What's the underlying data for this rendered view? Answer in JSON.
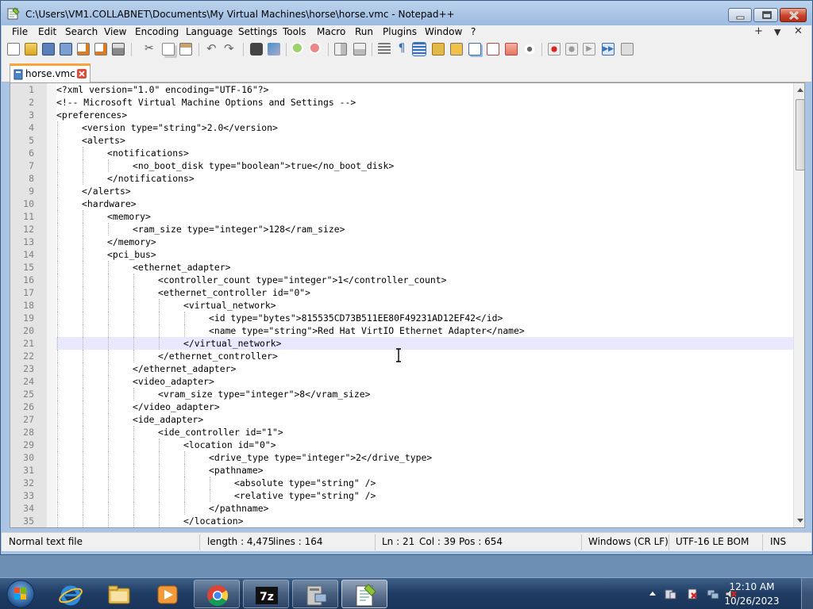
{
  "window": {
    "title": "C:\\Users\\VM1.COLLABNET\\Documents\\My Virtual Machines\\horse\\horse.vmc - Notepad++"
  },
  "menu": {
    "items": [
      "File",
      "Edit",
      "Search",
      "View",
      "Encoding",
      "Language",
      "Settings",
      "Tools",
      "Macro",
      "Run",
      "Plugins",
      "Window",
      "?"
    ],
    "right": [
      "+",
      "▼",
      "✕"
    ]
  },
  "toolbar": {
    "icons": [
      "new-file-icon",
      "open-file-icon",
      "save-icon",
      "save-all-icon",
      "close-icon",
      "close-all-icon",
      "print-icon",
      "cut-icon",
      "copy-icon",
      "paste-icon",
      "undo-icon",
      "redo-icon",
      "find-icon",
      "replace-icon",
      "zoom-in-icon",
      "zoom-out-icon",
      "sync-vertical-icon",
      "sync-horizontal-icon",
      "word-wrap-icon",
      "show-all-chars-icon",
      "indent-guide-icon",
      "user-language-icon",
      "doc-map-icon",
      "function-list-icon",
      "folder-as-workspace-icon",
      "monitoring-icon",
      "record-macro-icon",
      "stop-macro-icon",
      "play-macro-icon",
      "run-macro-multiple-icon",
      "save-macro-icon"
    ]
  },
  "tabs": [
    {
      "label": "horse.vmc",
      "active": true
    }
  ],
  "editor": {
    "active_line": 21,
    "lines": [
      {
        "n": "1",
        "indent": 0,
        "text": "<?xml version=\"1.0\" encoding=\"UTF-16\"?>"
      },
      {
        "n": "2",
        "indent": 0,
        "text": "<!-- Microsoft Virtual Machine Options and Settings -->"
      },
      {
        "n": "3",
        "indent": 0,
        "text": "<preferences>"
      },
      {
        "n": "4",
        "indent": 1,
        "text": "<version type=\"string\">2.0</version>"
      },
      {
        "n": "5",
        "indent": 1,
        "text": "<alerts>"
      },
      {
        "n": "6",
        "indent": 2,
        "text": "<notifications>"
      },
      {
        "n": "7",
        "indent": 3,
        "text": "<no_boot_disk type=\"boolean\">true</no_boot_disk>"
      },
      {
        "n": "8",
        "indent": 2,
        "text": "</notifications>"
      },
      {
        "n": "9",
        "indent": 1,
        "text": "</alerts>"
      },
      {
        "n": "10",
        "indent": 1,
        "text": "<hardware>"
      },
      {
        "n": "11",
        "indent": 2,
        "text": "<memory>"
      },
      {
        "n": "12",
        "indent": 3,
        "text": "<ram_size type=\"integer\">128</ram_size>"
      },
      {
        "n": "13",
        "indent": 2,
        "text": "</memory>"
      },
      {
        "n": "14",
        "indent": 2,
        "text": "<pci_bus>"
      },
      {
        "n": "15",
        "indent": 3,
        "text": "<ethernet_adapter>"
      },
      {
        "n": "16",
        "indent": 4,
        "text": "<controller_count type=\"integer\">1</controller_count>"
      },
      {
        "n": "17",
        "indent": 4,
        "text": "<ethernet_controller id=\"0\">"
      },
      {
        "n": "18",
        "indent": 5,
        "text": "<virtual_network>"
      },
      {
        "n": "19",
        "indent": 6,
        "text": "<id type=\"bytes\">815535CD73B511EE80F49231AD12EF42</id>"
      },
      {
        "n": "20",
        "indent": 6,
        "text": "<name type=\"string\">Red Hat VirtIO Ethernet Adapter</name>"
      },
      {
        "n": "21",
        "indent": 5,
        "text": "</virtual_network>"
      },
      {
        "n": "22",
        "indent": 4,
        "text": "</ethernet_controller>"
      },
      {
        "n": "23",
        "indent": 3,
        "text": "</ethernet_adapter>"
      },
      {
        "n": "24",
        "indent": 3,
        "text": "<video_adapter>"
      },
      {
        "n": "25",
        "indent": 4,
        "text": "<vram_size type=\"integer\">8</vram_size>"
      },
      {
        "n": "26",
        "indent": 3,
        "text": "</video_adapter>"
      },
      {
        "n": "27",
        "indent": 3,
        "text": "<ide_adapter>"
      },
      {
        "n": "28",
        "indent": 4,
        "text": "<ide_controller id=\"1\">"
      },
      {
        "n": "29",
        "indent": 5,
        "text": "<location id=\"0\">"
      },
      {
        "n": "30",
        "indent": 6,
        "text": "<drive_type type=\"integer\">2</drive_type>"
      },
      {
        "n": "31",
        "indent": 6,
        "text": "<pathname>"
      },
      {
        "n": "32",
        "indent": 7,
        "text": "<absolute type=\"string\" />"
      },
      {
        "n": "33",
        "indent": 7,
        "text": "<relative type=\"string\" />"
      },
      {
        "n": "34",
        "indent": 6,
        "text": "</pathname>"
      },
      {
        "n": "35",
        "indent": 5,
        "text": "</location>"
      }
    ]
  },
  "status": {
    "file_type": "Normal text file",
    "length": "length : 4,475",
    "lines": "lines : 164",
    "ln": "Ln : 21",
    "col": "Col : 39",
    "pos": "Pos : 654",
    "eol": "Windows (CR LF)",
    "encoding": "UTF-16 LE BOM",
    "mode": "INS"
  },
  "taskbar": {
    "apps": [
      "internet-explorer-icon",
      "file-explorer-icon",
      "media-player-icon",
      "chrome-icon",
      "7zip-icon",
      "virtual-pc-icon",
      "notepad-plus-plus-icon"
    ],
    "tray_icons": [
      "show-hidden-icons-icon",
      "action-center-icon",
      "network-icon",
      "volume-icon"
    ],
    "time": "12:10 AM",
    "date": "10/26/2023"
  }
}
